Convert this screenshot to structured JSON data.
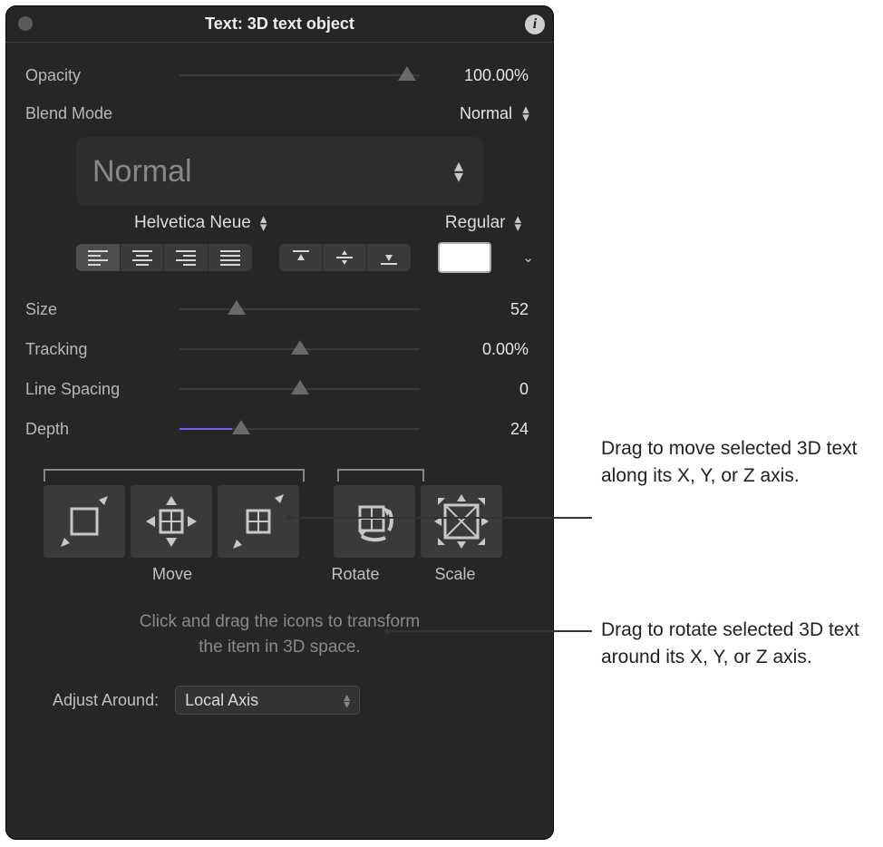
{
  "header": {
    "title": "Text: 3D text  object",
    "info_glyph": "i"
  },
  "props": {
    "opacity": {
      "label": "Opacity",
      "value": "100.00%"
    },
    "blend": {
      "label": "Blend Mode",
      "value": "Normal"
    },
    "style": {
      "name": "Normal"
    },
    "font": {
      "family": "Helvetica Neue",
      "weight": "Regular"
    },
    "size": {
      "label": "Size",
      "value": "52"
    },
    "tracking": {
      "label": "Tracking",
      "value": "0.00%"
    },
    "lineSpacing": {
      "label": "Line Spacing",
      "value": "0"
    },
    "depth": {
      "label": "Depth",
      "value": "24"
    }
  },
  "color_swatch": "#FFFFFF",
  "tools": {
    "move": {
      "label": "Move"
    },
    "rotate": {
      "label": "Rotate"
    },
    "scale": {
      "label": "Scale"
    }
  },
  "hint": {
    "line1": "Click and drag the icons to transform",
    "line2": "the item in 3D space."
  },
  "adjust": {
    "label": "Adjust Around:",
    "value": "Local Axis"
  },
  "callouts": {
    "move": "Drag to move selected 3D text along its X, Y, or Z axis.",
    "rotate": "Drag to rotate selected 3D text around its X, Y, or Z axis."
  }
}
